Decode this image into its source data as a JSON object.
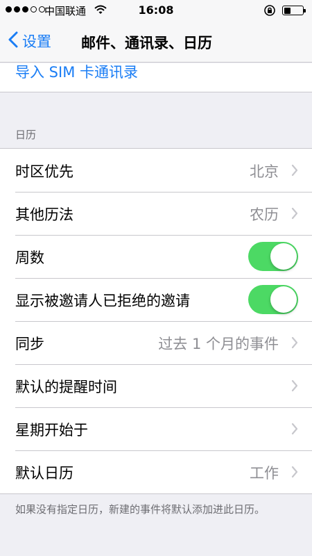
{
  "status_bar": {
    "carrier": "中国联通",
    "time": "16:08",
    "signal_bars_filled": 3,
    "signal_bars_total": 5
  },
  "nav": {
    "back_label": "设置",
    "title": "邮件、通讯录、日历"
  },
  "import_sim": "导入 SIM 卡通讯录",
  "calendar_section": {
    "header": "日历",
    "rows": [
      {
        "label": "时区优先",
        "value": "北京",
        "type": "disclosure"
      },
      {
        "label": "其他历法",
        "value": "农历",
        "type": "disclosure"
      },
      {
        "label": "周数",
        "type": "toggle",
        "on": true
      },
      {
        "label": "显示被邀请人已拒绝的邀请",
        "type": "toggle",
        "on": true
      },
      {
        "label": "同步",
        "value": "过去 1 个月的事件",
        "type": "disclosure"
      },
      {
        "label": "默认的提醒时间",
        "value": "",
        "type": "disclosure"
      },
      {
        "label": "星期开始于",
        "value": "",
        "type": "disclosure"
      },
      {
        "label": "默认日历",
        "value": "工作",
        "type": "disclosure"
      }
    ],
    "footer": "如果没有指定日历，新建的事件将默认添加进此日历。"
  },
  "colors": {
    "accent": "#1a7df5",
    "toggle_on": "#4cd964",
    "background": "#efeff4"
  }
}
